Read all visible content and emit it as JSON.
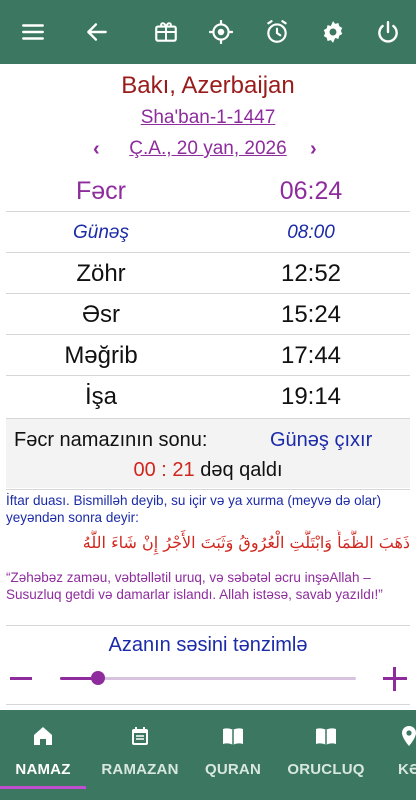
{
  "toolbar": {
    "icons": [
      "menu-icon",
      "back-arrow-icon",
      "calendar-gift-icon",
      "location-target-icon",
      "alarm-icon",
      "gear-icon",
      "power-icon"
    ]
  },
  "header": {
    "location": "Bakı, Azerbaijan",
    "hijri_date": "Sha'ban-1-1447",
    "gregorian_date": "Ç.A., 20 yan, 2026",
    "prev_arrow": "‹",
    "next_arrow": "›"
  },
  "prayer_times": [
    {
      "name": "Fəcr",
      "time": "06:24"
    },
    {
      "name": "Günəş",
      "time": "08:00"
    },
    {
      "name": "Zöhr",
      "time": "12:52"
    },
    {
      "name": "Əsr",
      "time": "15:24"
    },
    {
      "name": "Məğrib",
      "time": "17:44"
    },
    {
      "name": "İşa",
      "time": "19:14"
    }
  ],
  "end_info": {
    "label": "Fəcr namazının sonu:",
    "value": "Günəş çıxır",
    "countdown": "00 : 21",
    "suffix": "dəq qaldı"
  },
  "dua": {
    "intro": "İftar duası. Bismilləh deyib, su içir və ya xurma (meyvə də olar) yeyəndən sonra deyir:",
    "arabic": "ذَهَبَ الظَّمَأُ وَابْتَلَّتِ الْعُرُوقُ وَثَبَتَ الأَجْرُ إِنْ شَاءَ اللَّهُ",
    "transliteration": "“Zəhəbəz zaməu, vəbtəllətil uruq, və səbətəl əcru inşəAllah – Susuzluq getdi və damarlar islandı. Allah istəsə, savab yazıldı!”"
  },
  "azan": {
    "title": "Azanın səsini tənzimlə",
    "volume_fraction": 0.13
  },
  "bottom_nav": {
    "items": [
      {
        "label": "NAMAZ",
        "icon": "home-icon",
        "active": true
      },
      {
        "label": "RAMAZAN",
        "icon": "calendar-icon",
        "active": false
      },
      {
        "label": "QURAN",
        "icon": "book-icon",
        "active": false
      },
      {
        "label": "ORUCLUQ",
        "icon": "book-open-icon",
        "active": false
      },
      {
        "label": "KƏ",
        "icon": "location-pin-icon",
        "active": false
      }
    ]
  },
  "colors": {
    "bar": "#3c7762",
    "accent": "#8e2c9e",
    "blue": "#1b2ba8",
    "red": "#d0261e",
    "location": "#9a1b1b"
  }
}
